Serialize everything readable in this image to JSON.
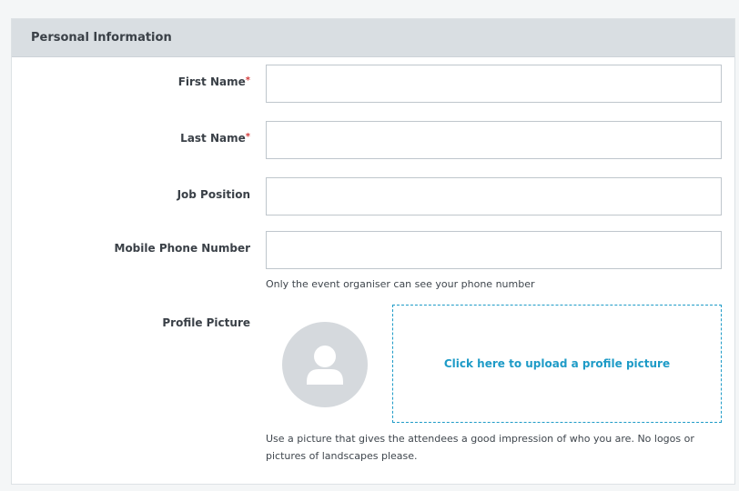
{
  "section": {
    "title": "Personal Information"
  },
  "fields": [
    {
      "label": "First Name",
      "required_mark": "*",
      "value": ""
    },
    {
      "label": "Last Name",
      "required_mark": "*",
      "value": ""
    },
    {
      "label": "Job Position",
      "required_mark": "",
      "value": ""
    },
    {
      "label": "Mobile Phone Number",
      "required_mark": "",
      "value": "",
      "help": "Only the event organiser can see your phone number"
    }
  ],
  "profile_picture": {
    "label": "Profile Picture",
    "upload_text": "Click here to upload a profile picture",
    "help": "Use a picture that gives the attendees a good impression of who you are. No logos or pictures of landscapes please.",
    "avatar_icon": "person-silhouette-icon"
  },
  "colors": {
    "accent": "#1e9bc7",
    "required": "#d33a3a",
    "header_bg": "#d9dee2"
  }
}
